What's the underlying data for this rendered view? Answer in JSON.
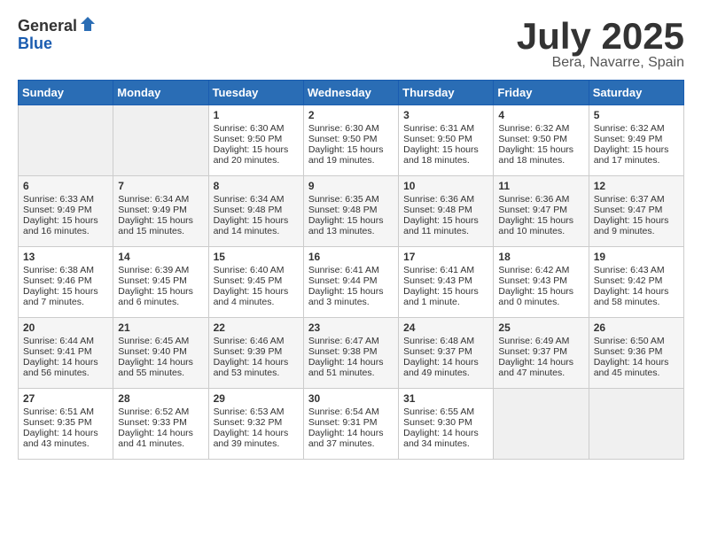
{
  "logo": {
    "general": "General",
    "blue": "Blue"
  },
  "title": {
    "month_year": "July 2025",
    "location": "Bera, Navarre, Spain"
  },
  "weekdays": [
    "Sunday",
    "Monday",
    "Tuesday",
    "Wednesday",
    "Thursday",
    "Friday",
    "Saturday"
  ],
  "weeks": [
    [
      {
        "day": "",
        "sunrise": "",
        "sunset": "",
        "daylight": ""
      },
      {
        "day": "",
        "sunrise": "",
        "sunset": "",
        "daylight": ""
      },
      {
        "day": "1",
        "sunrise": "Sunrise: 6:30 AM",
        "sunset": "Sunset: 9:50 PM",
        "daylight": "Daylight: 15 hours and 20 minutes."
      },
      {
        "day": "2",
        "sunrise": "Sunrise: 6:30 AM",
        "sunset": "Sunset: 9:50 PM",
        "daylight": "Daylight: 15 hours and 19 minutes."
      },
      {
        "day": "3",
        "sunrise": "Sunrise: 6:31 AM",
        "sunset": "Sunset: 9:50 PM",
        "daylight": "Daylight: 15 hours and 18 minutes."
      },
      {
        "day": "4",
        "sunrise": "Sunrise: 6:32 AM",
        "sunset": "Sunset: 9:50 PM",
        "daylight": "Daylight: 15 hours and 18 minutes."
      },
      {
        "day": "5",
        "sunrise": "Sunrise: 6:32 AM",
        "sunset": "Sunset: 9:49 PM",
        "daylight": "Daylight: 15 hours and 17 minutes."
      }
    ],
    [
      {
        "day": "6",
        "sunrise": "Sunrise: 6:33 AM",
        "sunset": "Sunset: 9:49 PM",
        "daylight": "Daylight: 15 hours and 16 minutes."
      },
      {
        "day": "7",
        "sunrise": "Sunrise: 6:34 AM",
        "sunset": "Sunset: 9:49 PM",
        "daylight": "Daylight: 15 hours and 15 minutes."
      },
      {
        "day": "8",
        "sunrise": "Sunrise: 6:34 AM",
        "sunset": "Sunset: 9:48 PM",
        "daylight": "Daylight: 15 hours and 14 minutes."
      },
      {
        "day": "9",
        "sunrise": "Sunrise: 6:35 AM",
        "sunset": "Sunset: 9:48 PM",
        "daylight": "Daylight: 15 hours and 13 minutes."
      },
      {
        "day": "10",
        "sunrise": "Sunrise: 6:36 AM",
        "sunset": "Sunset: 9:48 PM",
        "daylight": "Daylight: 15 hours and 11 minutes."
      },
      {
        "day": "11",
        "sunrise": "Sunrise: 6:36 AM",
        "sunset": "Sunset: 9:47 PM",
        "daylight": "Daylight: 15 hours and 10 minutes."
      },
      {
        "day": "12",
        "sunrise": "Sunrise: 6:37 AM",
        "sunset": "Sunset: 9:47 PM",
        "daylight": "Daylight: 15 hours and 9 minutes."
      }
    ],
    [
      {
        "day": "13",
        "sunrise": "Sunrise: 6:38 AM",
        "sunset": "Sunset: 9:46 PM",
        "daylight": "Daylight: 15 hours and 7 minutes."
      },
      {
        "day": "14",
        "sunrise": "Sunrise: 6:39 AM",
        "sunset": "Sunset: 9:45 PM",
        "daylight": "Daylight: 15 hours and 6 minutes."
      },
      {
        "day": "15",
        "sunrise": "Sunrise: 6:40 AM",
        "sunset": "Sunset: 9:45 PM",
        "daylight": "Daylight: 15 hours and 4 minutes."
      },
      {
        "day": "16",
        "sunrise": "Sunrise: 6:41 AM",
        "sunset": "Sunset: 9:44 PM",
        "daylight": "Daylight: 15 hours and 3 minutes."
      },
      {
        "day": "17",
        "sunrise": "Sunrise: 6:41 AM",
        "sunset": "Sunset: 9:43 PM",
        "daylight": "Daylight: 15 hours and 1 minute."
      },
      {
        "day": "18",
        "sunrise": "Sunrise: 6:42 AM",
        "sunset": "Sunset: 9:43 PM",
        "daylight": "Daylight: 15 hours and 0 minutes."
      },
      {
        "day": "19",
        "sunrise": "Sunrise: 6:43 AM",
        "sunset": "Sunset: 9:42 PM",
        "daylight": "Daylight: 14 hours and 58 minutes."
      }
    ],
    [
      {
        "day": "20",
        "sunrise": "Sunrise: 6:44 AM",
        "sunset": "Sunset: 9:41 PM",
        "daylight": "Daylight: 14 hours and 56 minutes."
      },
      {
        "day": "21",
        "sunrise": "Sunrise: 6:45 AM",
        "sunset": "Sunset: 9:40 PM",
        "daylight": "Daylight: 14 hours and 55 minutes."
      },
      {
        "day": "22",
        "sunrise": "Sunrise: 6:46 AM",
        "sunset": "Sunset: 9:39 PM",
        "daylight": "Daylight: 14 hours and 53 minutes."
      },
      {
        "day": "23",
        "sunrise": "Sunrise: 6:47 AM",
        "sunset": "Sunset: 9:38 PM",
        "daylight": "Daylight: 14 hours and 51 minutes."
      },
      {
        "day": "24",
        "sunrise": "Sunrise: 6:48 AM",
        "sunset": "Sunset: 9:37 PM",
        "daylight": "Daylight: 14 hours and 49 minutes."
      },
      {
        "day": "25",
        "sunrise": "Sunrise: 6:49 AM",
        "sunset": "Sunset: 9:37 PM",
        "daylight": "Daylight: 14 hours and 47 minutes."
      },
      {
        "day": "26",
        "sunrise": "Sunrise: 6:50 AM",
        "sunset": "Sunset: 9:36 PM",
        "daylight": "Daylight: 14 hours and 45 minutes."
      }
    ],
    [
      {
        "day": "27",
        "sunrise": "Sunrise: 6:51 AM",
        "sunset": "Sunset: 9:35 PM",
        "daylight": "Daylight: 14 hours and 43 minutes."
      },
      {
        "day": "28",
        "sunrise": "Sunrise: 6:52 AM",
        "sunset": "Sunset: 9:33 PM",
        "daylight": "Daylight: 14 hours and 41 minutes."
      },
      {
        "day": "29",
        "sunrise": "Sunrise: 6:53 AM",
        "sunset": "Sunset: 9:32 PM",
        "daylight": "Daylight: 14 hours and 39 minutes."
      },
      {
        "day": "30",
        "sunrise": "Sunrise: 6:54 AM",
        "sunset": "Sunset: 9:31 PM",
        "daylight": "Daylight: 14 hours and 37 minutes."
      },
      {
        "day": "31",
        "sunrise": "Sunrise: 6:55 AM",
        "sunset": "Sunset: 9:30 PM",
        "daylight": "Daylight: 14 hours and 34 minutes."
      },
      {
        "day": "",
        "sunrise": "",
        "sunset": "",
        "daylight": ""
      },
      {
        "day": "",
        "sunrise": "",
        "sunset": "",
        "daylight": ""
      }
    ]
  ]
}
